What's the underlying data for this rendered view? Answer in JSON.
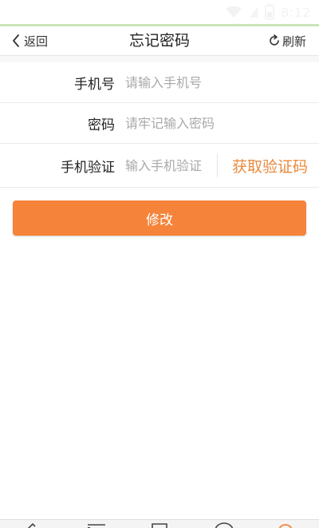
{
  "status_bar": {
    "time": "8:12",
    "icons": [
      "wifi-icon",
      "signal-icon",
      "battery-icon"
    ]
  },
  "colors": {
    "accent": "#f5833a",
    "link_orange": "#e98a3e",
    "status_accent_line": "#c9e6b8"
  },
  "nav": {
    "back_label": "返回",
    "title": "忘记密码",
    "refresh_label": "刷新"
  },
  "form": {
    "phone": {
      "label": "手机号",
      "placeholder": "请输入手机号",
      "value": ""
    },
    "password": {
      "label": "密码",
      "placeholder": "请牢记输入密码",
      "value": ""
    },
    "verify": {
      "label": "手机验证",
      "placeholder": "输入手机验证",
      "value": "",
      "get_code_label": "获取验证码"
    }
  },
  "submit": {
    "label": "修改"
  },
  "tab_bar": {
    "icons": [
      "edit-icon",
      "list-icon",
      "document-icon",
      "circle-icon",
      "user-icon"
    ]
  }
}
